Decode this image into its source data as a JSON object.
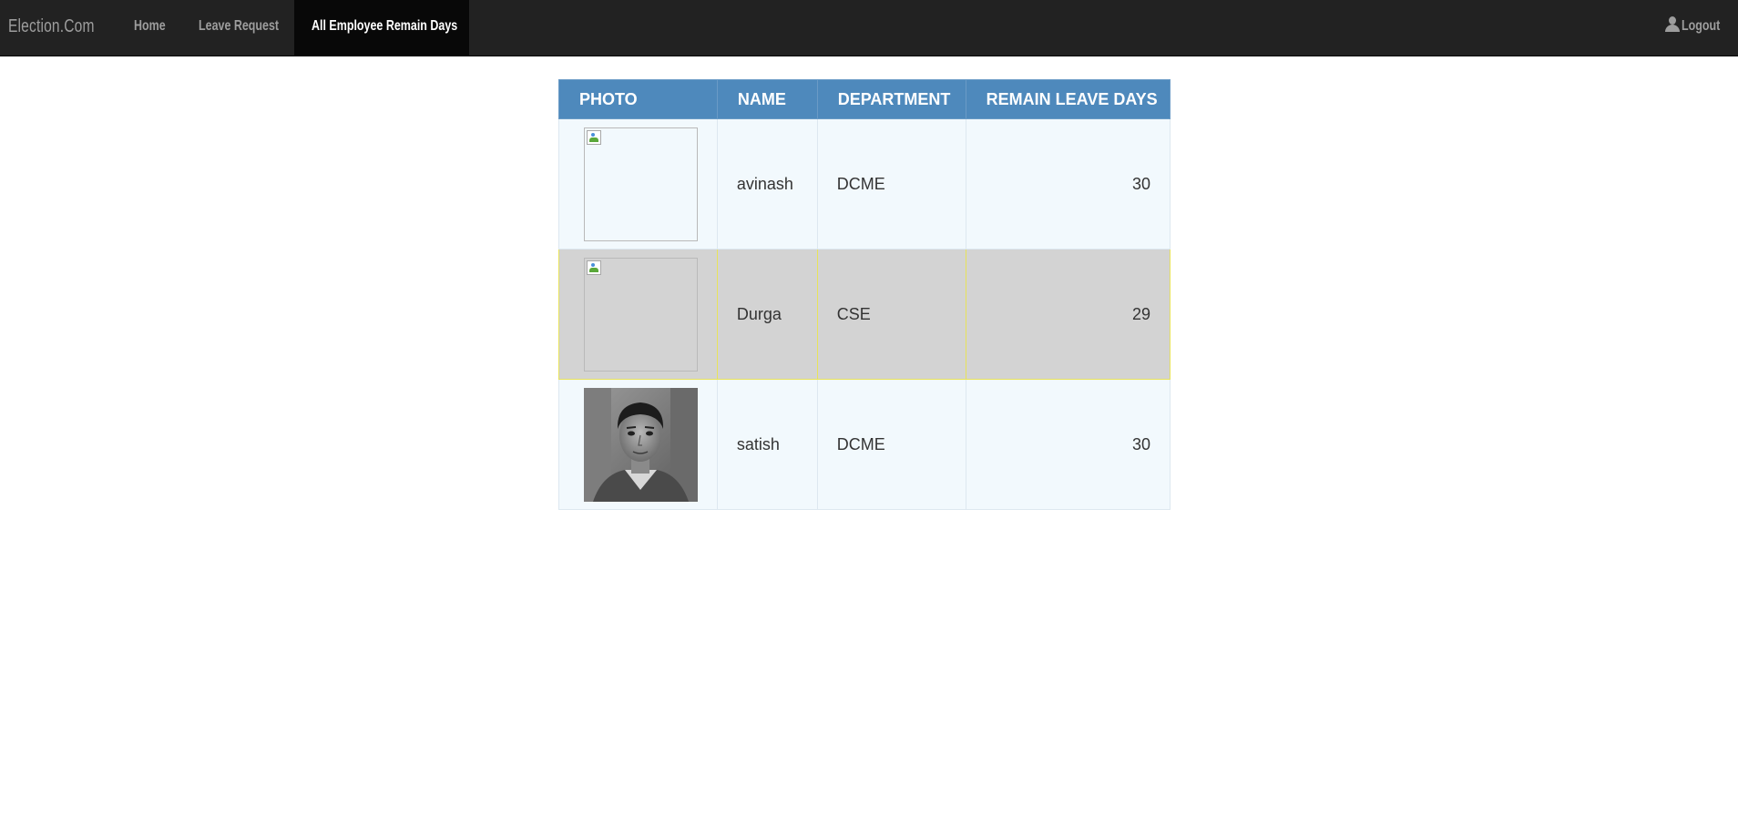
{
  "navbar": {
    "brand": "Election.Com",
    "items": [
      {
        "label": "Home"
      },
      {
        "label": "Leave Request"
      },
      {
        "label": "All Employee Remain Days",
        "active": true
      }
    ],
    "logout_label": "Logout",
    "logout_icon": "user-icon"
  },
  "table": {
    "headers": [
      "PHOTO",
      "NAME",
      "DEPARTMENT",
      "REMAIN LEAVE DAYS"
    ],
    "rows": [
      {
        "photo": "broken-image-icon",
        "name": "avinash",
        "department": "DCME",
        "days": "30"
      },
      {
        "photo": "broken-image-icon",
        "name": "Durga",
        "department": "CSE",
        "days": "29",
        "highlighted": true
      },
      {
        "photo": "employee-photo",
        "name": "satish",
        "department": "DCME",
        "days": "30"
      }
    ]
  },
  "colors": {
    "navbar_bg": "#222222",
    "nav_active_bg": "#080808",
    "table_header_bg": "#4e89bc",
    "row_bg": "#f2f9fd",
    "row_highlight_bg": "#d3d3d3",
    "row_highlight_border": "#e8e35a"
  }
}
